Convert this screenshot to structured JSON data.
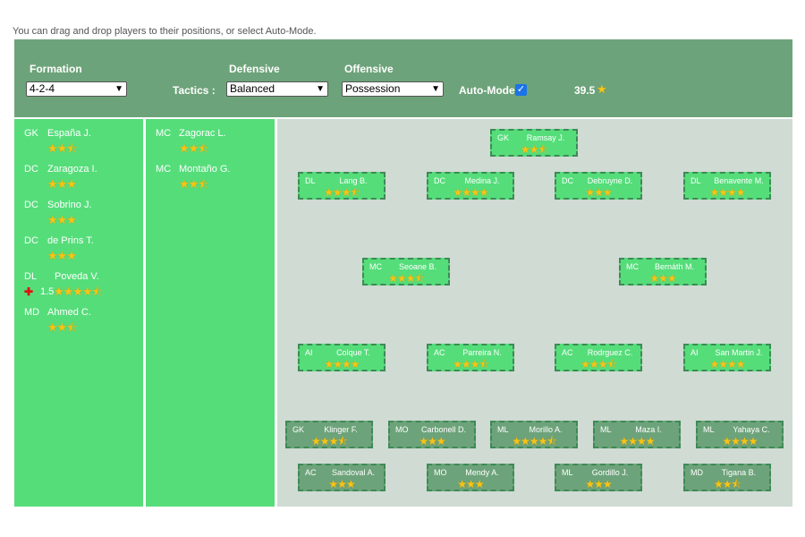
{
  "hint": "You can drag and drop players to their positions, or select Auto-Mode.",
  "controls": {
    "formation_label": "Formation",
    "formation_value": "4-2-4",
    "tactics_label": "Tactics :",
    "defensive_label": "Defensive",
    "defensive_value": "Balanced",
    "offensive_label": "Offensive",
    "offensive_value": "Possession",
    "automode_label": "Auto-Mode",
    "automode_checked": true,
    "rating": "39.5",
    "rating_icon": "star-icon"
  },
  "bench_left": [
    {
      "pos": "GK",
      "name": "España J.",
      "stars": "★★⯪"
    },
    {
      "pos": "DC",
      "name": "Zaragoza I.",
      "stars": "★★★"
    },
    {
      "pos": "DC",
      "name": "Sobrino J.",
      "stars": "★★★"
    },
    {
      "pos": "DC",
      "name": "de Prins T.",
      "stars": "★★★"
    },
    {
      "pos": "DL",
      "name": "Poveda V.",
      "stars": "★★★★⯪",
      "injury_icon": "red-cross-icon",
      "injury": "1.5"
    },
    {
      "pos": "MD",
      "name": "Ahmed C.",
      "stars": "★★⯪"
    }
  ],
  "bench_mid": [
    {
      "pos": "MC",
      "name": "Zagorac L.",
      "stars": "★★⯪"
    },
    {
      "pos": "MC",
      "name": "Montaño G.",
      "stars": "★★⯪"
    }
  ],
  "pitch": [
    {
      "pos": "GK",
      "name": "Ramsay J.",
      "stars": "★★⯪"
    },
    {
      "pos": "DL",
      "name": "Lang B.",
      "stars": "★★★⯪"
    },
    {
      "pos": "DC",
      "name": "Medina J.",
      "stars": "★★★★"
    },
    {
      "pos": "DC",
      "name": "Debruyne D.",
      "stars": "★★★"
    },
    {
      "pos": "DL",
      "name": "Benavente M.",
      "stars": "★★★★"
    },
    {
      "pos": "MC",
      "name": "Seoane B.",
      "stars": "★★★⯪"
    },
    {
      "pos": "MC",
      "name": "Bernáth M.",
      "stars": "★★★"
    },
    {
      "pos": "AI",
      "name": "Colque T.",
      "stars": "★★★★"
    },
    {
      "pos": "AC",
      "name": "Parreira N.",
      "stars": "★★★⯪"
    },
    {
      "pos": "AC",
      "name": "Rodrguez C.",
      "stars": "★★★⯪"
    },
    {
      "pos": "AI",
      "name": "San Martin J.",
      "stars": "★★★★"
    }
  ],
  "reserves": [
    {
      "pos": "GK",
      "name": "Klinger F.",
      "stars": "★★★⯪"
    },
    {
      "pos": "MO",
      "name": "Carbonell D.",
      "stars": "★★★"
    },
    {
      "pos": "ML",
      "name": "Morillo A.",
      "stars": "★★★★⯪"
    },
    {
      "pos": "ML",
      "name": "Maza I.",
      "stars": "★★★★"
    },
    {
      "pos": "ML",
      "name": "Yahaya C.",
      "stars": "★★★★"
    },
    {
      "pos": "AC",
      "name": "Sandoval A.",
      "stars": "★★★"
    },
    {
      "pos": "MO",
      "name": "Mendy A.",
      "stars": "★★★"
    },
    {
      "pos": "ML",
      "name": "Gordillo J.",
      "stars": "★★★"
    },
    {
      "pos": "MD",
      "name": "Tigana B.",
      "stars": "★★⯪"
    }
  ],
  "colors": {
    "header": "#6da37a",
    "bench": "#55dd7a",
    "pitch": "#cfdbd3",
    "star": "#f5c518"
  }
}
